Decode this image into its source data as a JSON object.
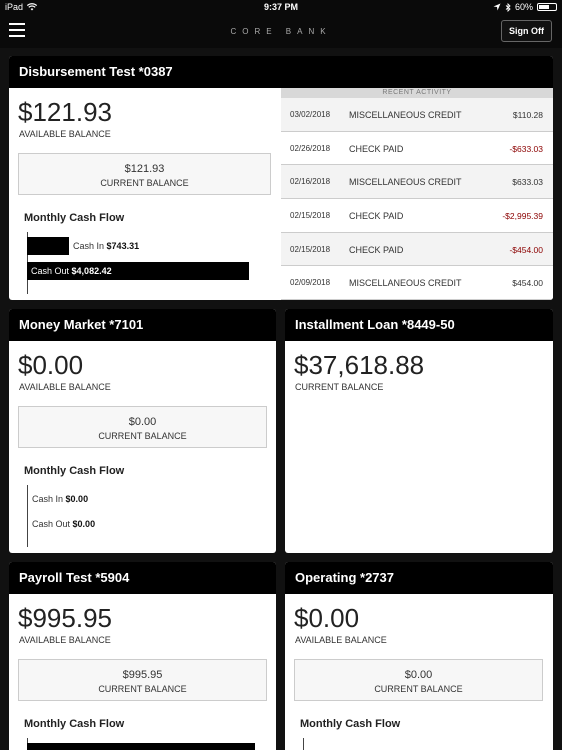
{
  "status_bar": {
    "device": "iPad",
    "time": "9:37 PM",
    "battery": "60%",
    "battery_fraction": 0.6
  },
  "nav": {
    "brand": "CORE BANK",
    "sign_off": "Sign Off"
  },
  "colors": {
    "negative": "#8b0000",
    "header": "#000000"
  },
  "accounts": [
    {
      "title": "Disbursement Test *0387",
      "available_balance": "$121.93",
      "available_label": "AVAILABLE BALANCE",
      "current_balance": "$121.93",
      "current_label": "CURRENT BALANCE",
      "cash_flow": {
        "title": "Monthly Cash Flow",
        "cash_in_label": "Cash In",
        "cash_in": "$743.31",
        "cash_in_value": 743.31,
        "cash_out_label": "Cash Out",
        "cash_out": "$4,082.42",
        "cash_out_value": 4082.42
      },
      "recent_activity": {
        "title": "RECENT ACTIVITY",
        "rows": [
          {
            "date": "03/02/2018",
            "description": "MISCELLANEOUS CREDIT",
            "amount": "$110.28",
            "negative": false
          },
          {
            "date": "02/26/2018",
            "description": "CHECK PAID",
            "amount": "-$633.03",
            "negative": true
          },
          {
            "date": "02/16/2018",
            "description": "MISCELLANEOUS CREDIT",
            "amount": "$633.03",
            "negative": false
          },
          {
            "date": "02/15/2018",
            "description": "CHECK PAID",
            "amount": "-$2,995.39",
            "negative": true
          },
          {
            "date": "02/15/2018",
            "description": "CHECK PAID",
            "amount": "-$454.00",
            "negative": true
          },
          {
            "date": "02/09/2018",
            "description": "MISCELLANEOUS CREDIT",
            "amount": "$454.00",
            "negative": false
          }
        ]
      }
    },
    {
      "title": "Money Market *7101",
      "available_balance": "$0.00",
      "available_label": "AVAILABLE BALANCE",
      "current_balance": "$0.00",
      "current_label": "CURRENT BALANCE",
      "cash_flow": {
        "title": "Monthly Cash Flow",
        "cash_in_label": "Cash In",
        "cash_in": "$0.00",
        "cash_out_label": "Cash Out",
        "cash_out": "$0.00"
      }
    },
    {
      "title": "Installment Loan *8449-50",
      "current_balance": "$37,618.88",
      "current_label": "CURRENT BALANCE"
    },
    {
      "title": "Payroll Test *5904",
      "available_balance": "$995.95",
      "available_label": "AVAILABLE BALANCE",
      "current_balance": "$995.95",
      "current_label": "CURRENT BALANCE",
      "cash_flow": {
        "title": "Monthly Cash Flow"
      }
    },
    {
      "title": "Operating *2737",
      "available_balance": "$0.00",
      "available_label": "AVAILABLE BALANCE",
      "current_balance": "$0.00",
      "current_label": "CURRENT BALANCE",
      "cash_flow": {
        "title": "Monthly Cash Flow"
      }
    }
  ]
}
